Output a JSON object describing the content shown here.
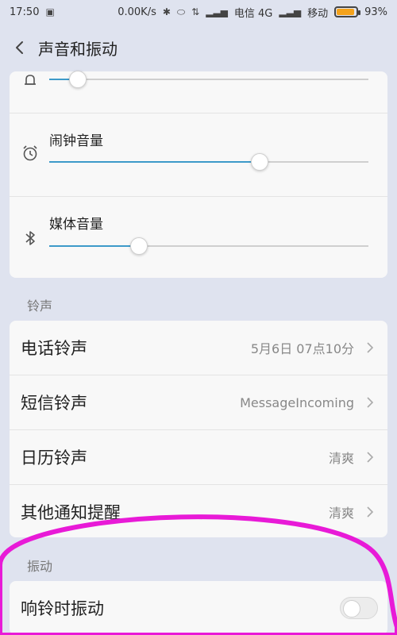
{
  "status_bar": {
    "time": "17:50",
    "speed": "0.00K/s",
    "carrier1": "电信 4G",
    "carrier2": "移动",
    "battery": "93%",
    "battery_level": 0.93
  },
  "header": {
    "title": "声音和振动"
  },
  "volume": {
    "rows": [
      {
        "label": "",
        "value": 0.09,
        "icon": "bell-icon"
      },
      {
        "label": "闹钟音量",
        "value": 0.66,
        "icon": "alarm-clock-icon"
      },
      {
        "label": "媒体音量",
        "value": 0.28,
        "icon": "bluetooth-icon"
      }
    ]
  },
  "sections": {
    "ringtone": "铃声",
    "vibrate": "振动"
  },
  "ringtones": [
    {
      "title": "电话铃声",
      "value": "5月6日 07点10分"
    },
    {
      "title": "短信铃声",
      "value": "MessageIncoming"
    },
    {
      "title": "日历铃声",
      "value": "清爽"
    },
    {
      "title": "其他通知提醒",
      "value": "清爽"
    }
  ],
  "vibrate_on_ring": {
    "title": "响铃时振动",
    "enabled": false
  },
  "colors": {
    "accent": "#3d9ac9",
    "annotation": "#e81ad7",
    "battery": "#f4a21b"
  }
}
